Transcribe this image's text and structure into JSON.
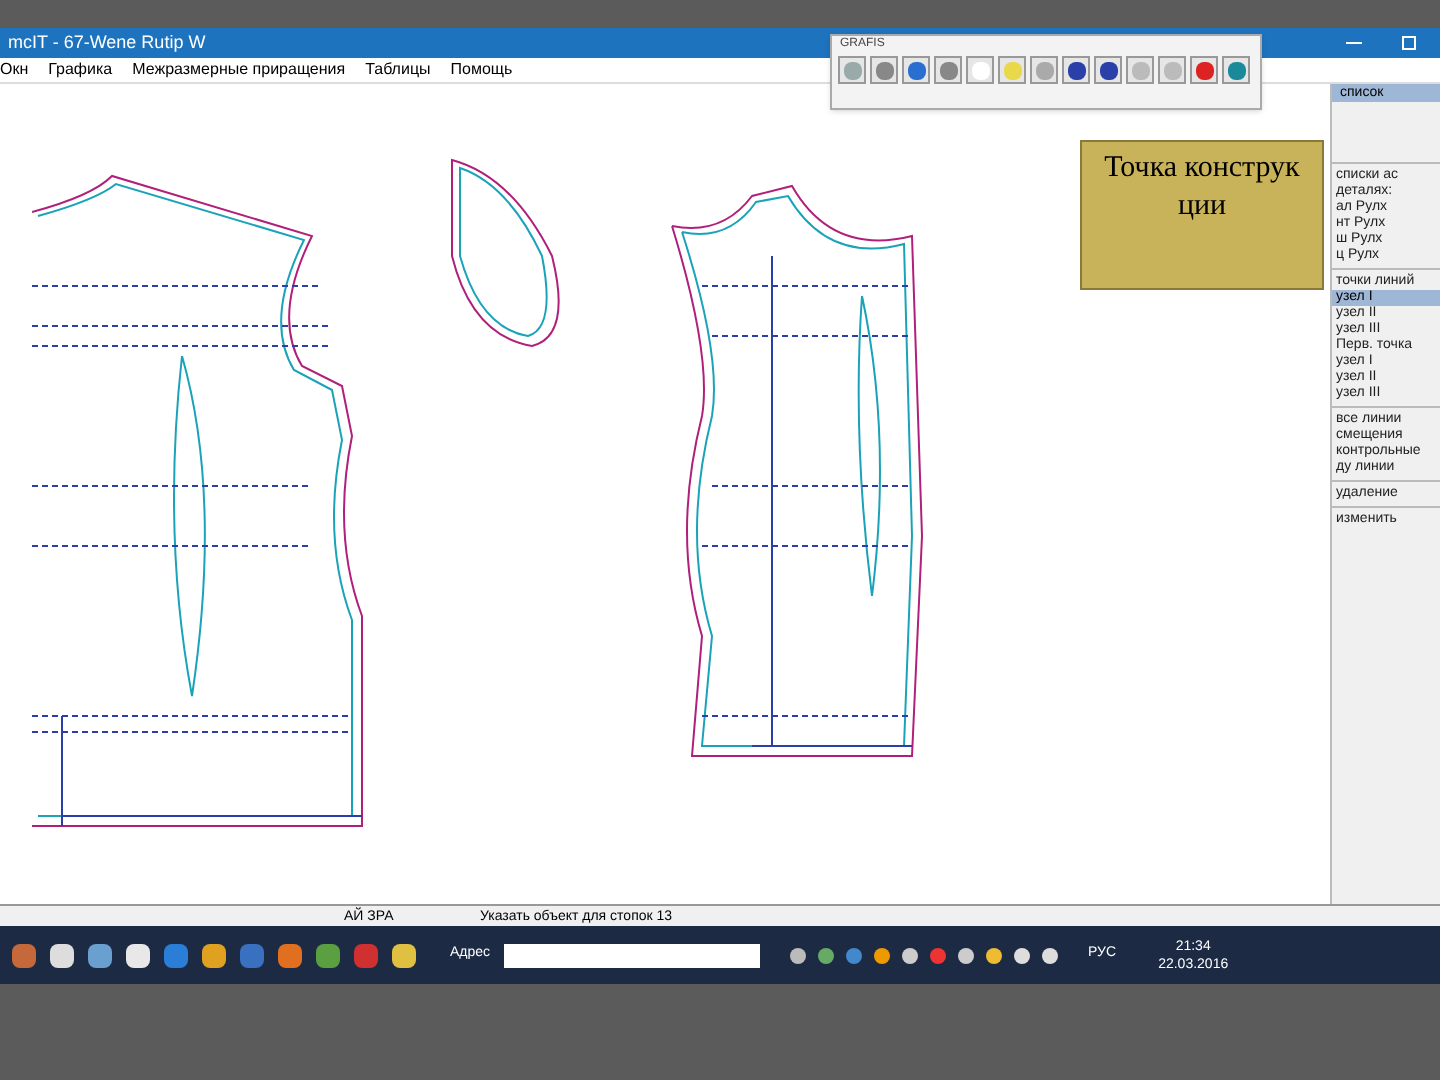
{
  "window": {
    "title": "mcIT - 67-Wene Rutip W"
  },
  "menu": [
    "Окн",
    "Графика",
    "Межразмерные приращения",
    "Таблицы",
    "Помощь"
  ],
  "toolbar": {
    "title": "GRAFIS"
  },
  "tooltip": "Точка конструкции",
  "side_panel": {
    "header": "список",
    "groups": [
      {
        "items": [
          {
            "label": "списки ас",
            "selected": false
          },
          {
            "label": "деталях:",
            "selected": false
          },
          {
            "label": "ал Рулх",
            "selected": false
          },
          {
            "label": "нт Рулх",
            "selected": false
          },
          {
            "label": "ш Рулх",
            "selected": false
          },
          {
            "label": "ц Рулх",
            "selected": false
          }
        ]
      },
      {
        "items": [
          {
            "label": "точки линий",
            "selected": false
          },
          {
            "label": "узел I",
            "selected": true
          },
          {
            "label": "узел II",
            "selected": false
          },
          {
            "label": "узел III",
            "selected": false
          },
          {
            "label": "Перв. точка",
            "selected": false
          },
          {
            "label": "узел I",
            "selected": false
          },
          {
            "label": "узел II",
            "selected": false
          },
          {
            "label": "узел III",
            "selected": false
          }
        ]
      },
      {
        "items": [
          {
            "label": "все линии",
            "selected": false
          },
          {
            "label": "смещения",
            "selected": false
          },
          {
            "label": "контрольные",
            "selected": false
          },
          {
            "label": "ду линии",
            "selected": false
          }
        ]
      },
      {
        "items": [
          {
            "label": "удаление",
            "selected": false
          }
        ]
      },
      {
        "items": [
          {
            "label": "изменить",
            "selected": false
          }
        ]
      }
    ]
  },
  "status_bar": [
    "АЙ ЗРА",
    "Указать объект для стопок 13"
  ],
  "taskbar": {
    "address_label": "Адрес",
    "language": "РУС",
    "time": "21:34",
    "date": "22.03.2016"
  }
}
